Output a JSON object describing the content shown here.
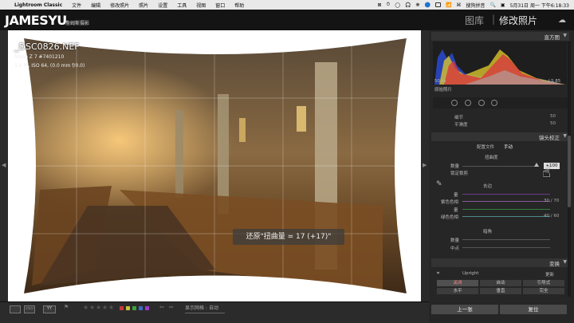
{
  "menubar": {
    "items": [
      "Lightroom Classic",
      "文件",
      "编辑",
      "修改照片",
      "照片",
      "设置",
      "工具",
      "视图",
      "窗口",
      "帮助"
    ],
    "extras": [
      "⊠",
      "⏱",
      "◯",
      "🎧",
      "❋",
      "🔵",
      "🔋",
      "微信",
      "📶",
      "⌘",
      "⏸",
      "📋",
      "🔍",
      "▣"
    ],
    "input_method": "搜狗拼音",
    "clock": "5月31日 周一 下午6:18:33"
  },
  "identity": {
    "brand": "JAMESYU",
    "brand_cn": "詹姆斯摄影"
  },
  "modules": {
    "library": "图库",
    "separator": "|",
    "develop": "修改照片",
    "cloud_icon": "cloud-icon"
  },
  "photo": {
    "filename": "_DSC0826.NEF",
    "camera": "Nikon Z 7 #7401210",
    "exposure": "5.0 秒, ISO 64, (0.0 mm f/0.0)",
    "hud": "还原\"扭曲量 = 17 (+17)\""
  },
  "toolbar": {
    "view_modes": [
      "▭",
      "▭▭",
      "YY"
    ],
    "flag_icon": "flag-icon",
    "stars": [
      "★",
      "★",
      "★",
      "★",
      "★"
    ],
    "colors": [
      "#c23b3b",
      "#c9c33b",
      "#3ba23b",
      "#3b6bc9",
      "#9b3bc9"
    ],
    "grid_label": "显示网格 :",
    "grid_value": "自动"
  },
  "panel": {
    "histogram_title": "直方图",
    "histogram_low": "50 ss",
    "histogram_high": "LS 85",
    "original_photo": "原始照片",
    "detail_label": "细节",
    "detail_value": "50",
    "smooth_label": "平滑度",
    "smooth_value": "50",
    "lens_title": "镜头校正",
    "tab_profile": "配置文件",
    "tab_manual": "手动",
    "distortion_title": "扭曲度",
    "amount_label": "数量",
    "amount_value": "+100",
    "constrain_label": "锁定裁剪",
    "defringe_title": "去边",
    "qty_label": "量",
    "purple_hue": "紫色色相",
    "purple_hue_value": "30 / 70",
    "green_hue": "绿色色相",
    "green_hue_value": "40 / 60",
    "vignette_title": "暗角",
    "vig_amount": "数量",
    "midpoint": "中点",
    "transform_title": "变换",
    "upright": "Upright",
    "update": "更新",
    "seg_row1": [
      "关闭",
      "自动",
      "引导式"
    ],
    "seg_row2": [
      "水平",
      "垂直",
      "完全"
    ],
    "prev_btn": "上一张",
    "reset_btn": "复位"
  }
}
